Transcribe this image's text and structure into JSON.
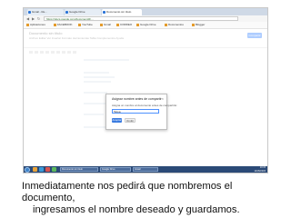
{
  "browser": {
    "tabs": [
      {
        "label": "Gmail - Re...",
        "active": false
      },
      {
        "label": "Google Drive",
        "active": false
      },
      {
        "label": "Documento sin título",
        "active": true
      }
    ],
    "url": "https://docs.google.com/document/d/...",
    "bookmarks": [
      "Aplicaciones",
      "FACEBOOK",
      "YouTube",
      "Gmail",
      "CORREO",
      "Google Drive",
      "Documentos",
      "Blogger"
    ]
  },
  "docs": {
    "title": "Documento sin título",
    "menu": "Archivo  Editar  Ver  Insertar  Formato  Herramientas  Tabla  Complementos  Ayuda",
    "share_label": "Compartir"
  },
  "dialog": {
    "title": "Asignar nombre antes de compartir",
    "prompt": "Asigna un nombre al documento antes de compartirlo:",
    "input_value": "Tarea",
    "ok_label": "Aceptar",
    "cancel_label": "Omitir",
    "close_glyph": "×"
  },
  "taskbar": {
    "apps": [
      "Documento sin título",
      "Google Drive",
      "Gmail"
    ],
    "time": "10:15",
    "date": "14/05/2015"
  },
  "caption": {
    "line1": "Inmediatamente nos pedirá que nombremos el documento,",
    "line2": "ingresamos el nombre deseado y guardamos."
  }
}
